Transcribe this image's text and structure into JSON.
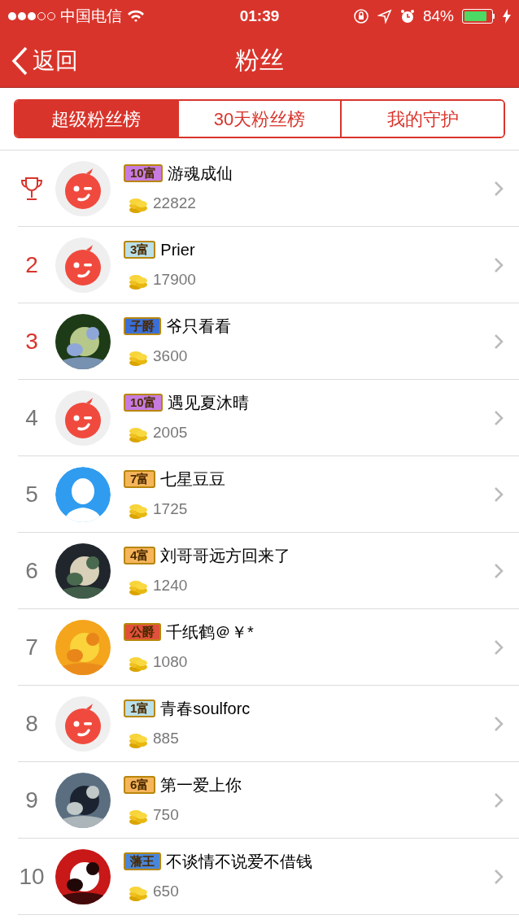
{
  "status_bar": {
    "carrier": "中国电信",
    "time": "01:39",
    "battery_text": "84%"
  },
  "nav": {
    "back": "返回",
    "title": "粉丝"
  },
  "tabs": [
    {
      "label": "超级粉丝榜",
      "selected": true
    },
    {
      "label": "30天粉丝榜",
      "selected": false
    },
    {
      "label": "我的守护",
      "selected": false
    }
  ],
  "fans": [
    {
      "kind": "trophy",
      "avatar": {
        "kind": "default"
      },
      "badge": {
        "label": "10富",
        "color": "#c77be0"
      },
      "name": "游魂成仙",
      "coins": "22822"
    },
    {
      "kind": "top",
      "rank": "2",
      "avatar": {
        "kind": "default"
      },
      "badge": {
        "label": "3富",
        "color": "#b9dfe8"
      },
      "name": "Prier",
      "coins": "17900"
    },
    {
      "kind": "top",
      "rank": "3",
      "badge": {
        "label": "子爵",
        "color": "#3a6fd8"
      },
      "name": "爷只看看",
      "coins": "3600"
    },
    {
      "kind": "normal",
      "rank": "4",
      "avatar": {
        "kind": "default"
      },
      "badge": {
        "label": "10富",
        "color": "#c77be0"
      },
      "name": "遇见夏沐晴",
      "coins": "2005"
    },
    {
      "kind": "normal",
      "rank": "5",
      "avatar": {
        "kind": "silhouette"
      },
      "badge": {
        "label": "7富",
        "color": "#f6b55a"
      },
      "name": "七星豆豆",
      "coins": "1725"
    },
    {
      "kind": "normal",
      "rank": "6",
      "badge": {
        "label": "4富",
        "color": "#f6b55a"
      },
      "name": "刘哥哥远方回来了",
      "coins": "1240"
    },
    {
      "kind": "normal",
      "rank": "7",
      "badge": {
        "label": "公爵",
        "color": "#e0503a"
      },
      "name": "千纸鹤＠￥*",
      "coins": "1080"
    },
    {
      "kind": "normal",
      "rank": "8",
      "avatar": {
        "kind": "default"
      },
      "badge": {
        "label": "1富",
        "color": "#b9dfe8"
      },
      "name": "青春soulforc",
      "coins": "885"
    },
    {
      "kind": "normal",
      "rank": "9",
      "badge": {
        "label": "6富",
        "color": "#f6b55a"
      },
      "name": "第一爱上你",
      "coins": "750"
    },
    {
      "kind": "normal",
      "rank": "10",
      "badge": {
        "label": "藩王",
        "color": "#4a86d8"
      },
      "name": "不谈情不说爱不借钱",
      "coins": "650"
    }
  ]
}
